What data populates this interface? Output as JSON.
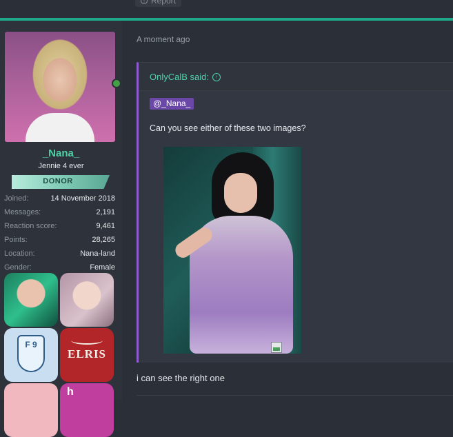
{
  "post": {
    "report_label": "Report",
    "timestamp": "A moment ago",
    "reply_text": "i can see the right one"
  },
  "user": {
    "username": "_Nana_",
    "title": "Jennie 4 ever",
    "banner": "DONOR",
    "stats": [
      {
        "label": "Joined:",
        "value": "14 November 2018"
      },
      {
        "label": "Messages:",
        "value": "2,191"
      },
      {
        "label": "Reaction score:",
        "value": "9,461"
      },
      {
        "label": "Points:",
        "value": "28,265"
      },
      {
        "label": "Location:",
        "value": "Nana-land"
      },
      {
        "label": "Gender:",
        "value": "Female"
      }
    ],
    "badges": {
      "school_letters": "F 9",
      "elris": "ELRIS",
      "partial": "h"
    }
  },
  "quote": {
    "author": "OnlyCalB said:",
    "mention": "@_Nana_",
    "text": "Can you see either of these two images?"
  },
  "colors": {
    "accent": "#1fa88a",
    "username": "#4fd1a8",
    "quote_border": "#8e5cd0",
    "mention_bg": "#6b48a8"
  }
}
